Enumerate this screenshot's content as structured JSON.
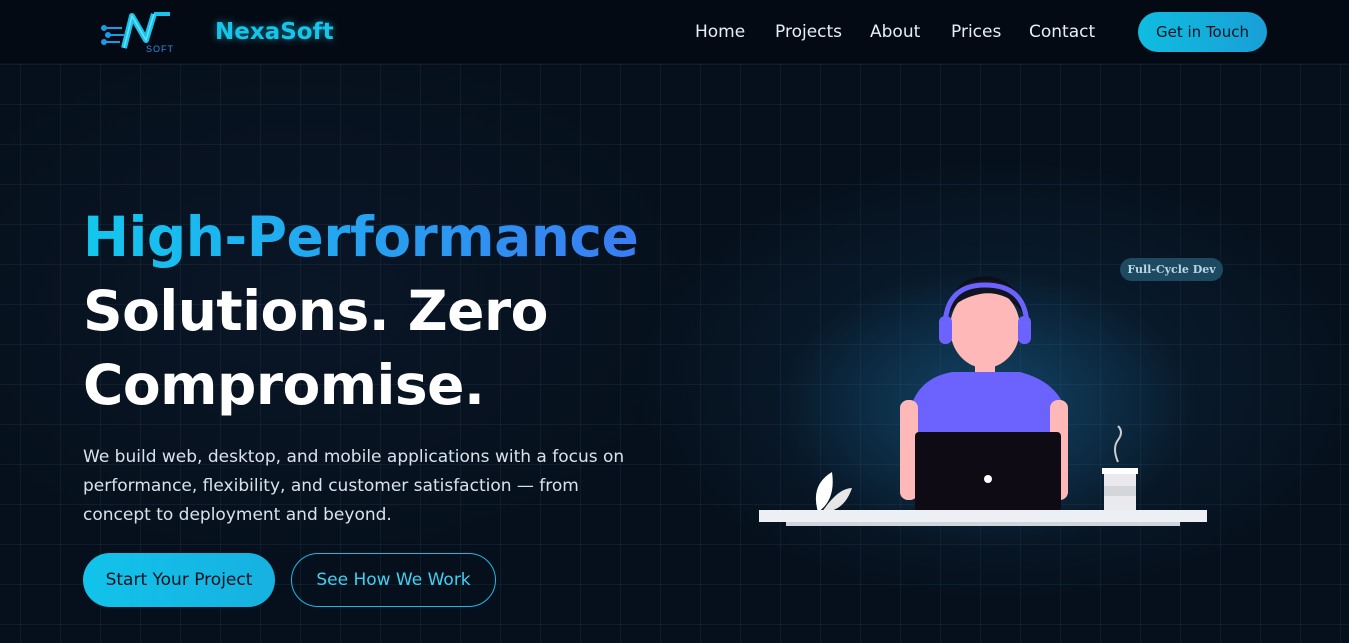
{
  "header": {
    "logo_letter": "N",
    "logo_sub": "SOFT",
    "brand": "NexaSoft",
    "nav": [
      {
        "label": "Home"
      },
      {
        "label": "Projects"
      },
      {
        "label": "About"
      },
      {
        "label": "Prices"
      },
      {
        "label": "Contact"
      }
    ],
    "cta_label": "Get in Touch"
  },
  "hero": {
    "title_line1": "High-Performance",
    "title_line2": "Solutions. Zero",
    "title_line3": "Compromise.",
    "description": "We build web, desktop, and mobile applications with a focus on performance, flexibility, and customer satisfaction — from concept to deployment and beyond.",
    "primary_button": "Start Your Project",
    "secondary_button": "See How We Work"
  },
  "illustration": {
    "badge": "Full-Cycle Dev",
    "icon": "developer-at-laptop-illustration"
  },
  "colors": {
    "background": "#06101c",
    "accent_cyan": "#14c6ea",
    "accent_blue": "#3a7cf2",
    "shirt": "#6c63ff",
    "skin": "#ffb8b8"
  }
}
